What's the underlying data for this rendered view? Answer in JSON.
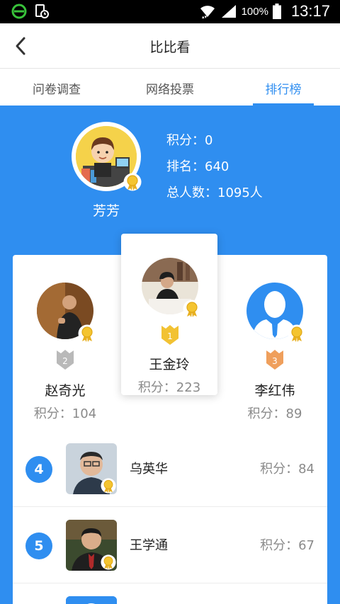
{
  "status_bar": {
    "battery": "100%",
    "time": "13:17"
  },
  "header": {
    "title": "比比看"
  },
  "tabs": [
    {
      "label": "问卷调查",
      "active": false
    },
    {
      "label": "网络投票",
      "active": false
    },
    {
      "label": "排行榜",
      "active": true
    }
  ],
  "me": {
    "name": "芳芳",
    "score_line": "积分：0",
    "rank_line": "排名：640",
    "total_line": "总人数：1095人"
  },
  "podium": [
    {
      "rank": "1",
      "name": "王金玲",
      "score": "积分：223"
    },
    {
      "rank": "2",
      "name": "赵奇光",
      "score": "积分：104"
    },
    {
      "rank": "3",
      "name": "李红伟",
      "score": "积分：89"
    }
  ],
  "list": [
    {
      "rank": "4",
      "name": "乌英华",
      "score": "积分：84"
    },
    {
      "rank": "5",
      "name": "王学通",
      "score": "积分：67"
    }
  ],
  "colors": {
    "accent": "#2f8ef0",
    "gold": "#f2c233",
    "silver": "#b9b9b9",
    "bronze": "#ef9f5c"
  }
}
